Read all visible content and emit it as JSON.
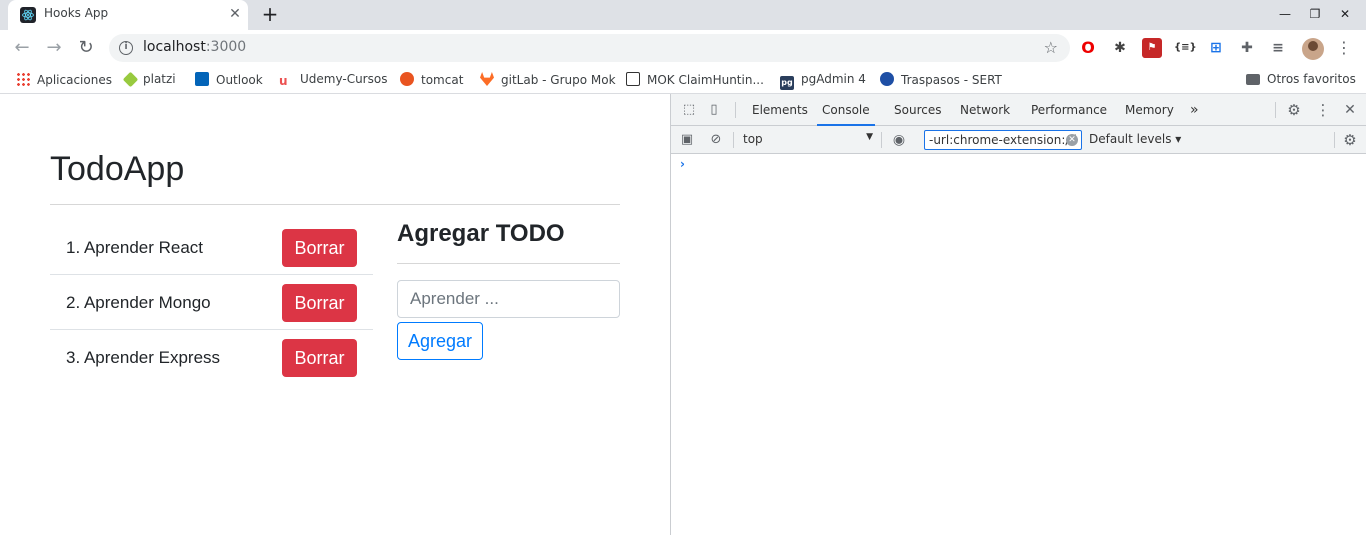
{
  "browser": {
    "tab_title": "Hooks App",
    "url_host": "localhost",
    "url_port": ":3000",
    "accent_color": "#1a73e8"
  },
  "bookmarks": [
    {
      "label": "Aplicaciones",
      "icon": "apps-grid-icon"
    },
    {
      "label": "platzi",
      "icon": "platzi-icon"
    },
    {
      "label": "Outlook",
      "icon": "outlook-icon"
    },
    {
      "label": "Udemy-Cursos",
      "icon": "udemy-icon"
    },
    {
      "label": "tomcat",
      "icon": "ubuntu-icon"
    },
    {
      "label": "gitLab - Grupo Mok",
      "icon": "gitlab-icon"
    },
    {
      "label": "MOK ClaimHuntin...",
      "icon": "mok-icon"
    },
    {
      "label": "pgAdmin 4",
      "icon": "pgadmin-icon"
    },
    {
      "label": "Traspasos - SERT",
      "icon": "sert-icon"
    },
    {
      "label": "Otros favoritos",
      "icon": "folder-icon"
    }
  ],
  "app": {
    "title": "TodoApp",
    "todos": [
      {
        "text": "1. Aprender React",
        "button": "Borrar"
      },
      {
        "text": "2. Aprender Mongo",
        "button": "Borrar"
      },
      {
        "text": "3. Aprender Express",
        "button": "Borrar"
      }
    ],
    "form_title": "Agregar TODO",
    "input_placeholder": "Aprender ...",
    "submit_label": "Agregar",
    "danger_color": "#dc3545",
    "primary_color": "#007bff"
  },
  "devtools": {
    "tabs": [
      "Elements",
      "Console",
      "Sources",
      "Network",
      "Performance",
      "Memory"
    ],
    "active_tab": "Console",
    "more_tabs": "»",
    "context": "top",
    "filter_value": "-url:chrome-extension://l",
    "levels": "Default levels ▾",
    "prompt": "›"
  }
}
